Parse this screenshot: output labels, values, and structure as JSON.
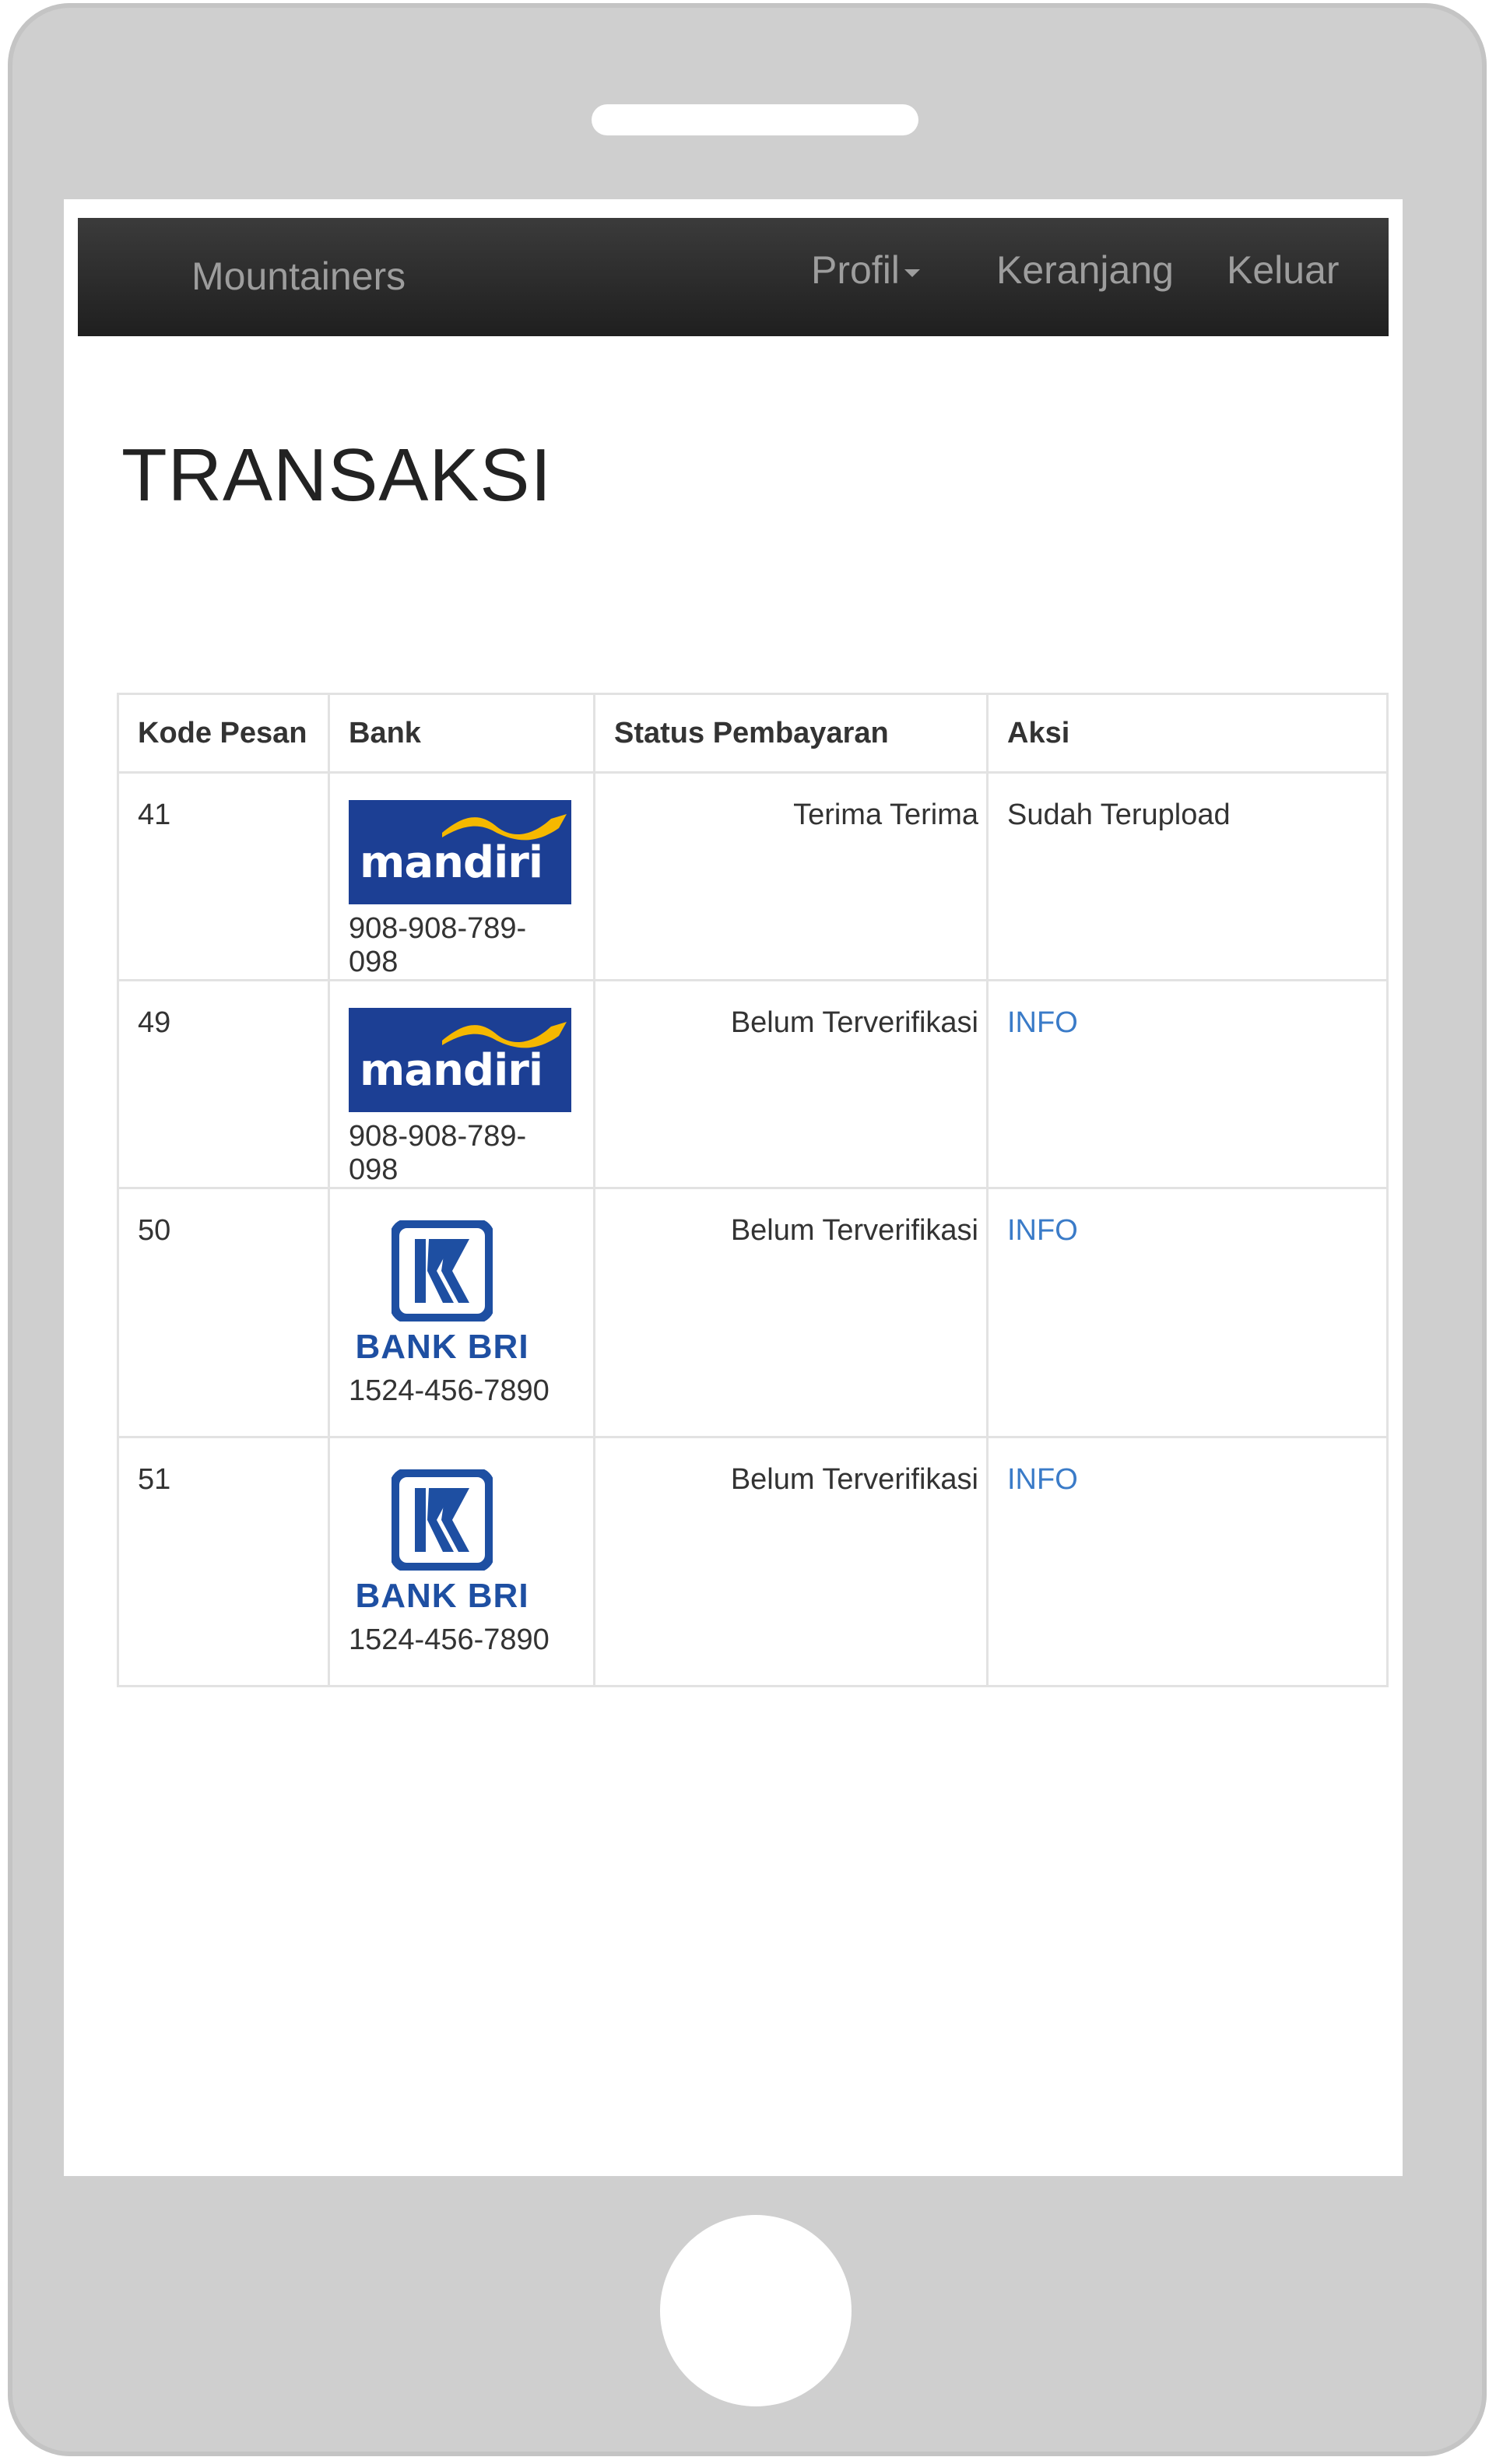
{
  "navbar": {
    "brand": "Mountainers",
    "items": [
      "Profil",
      "Keranjang",
      "Keluar"
    ]
  },
  "page": {
    "title": "TRANSAKSI"
  },
  "table": {
    "headers": [
      "Kode Pesan",
      "Bank",
      "Status Pembayaran",
      "Aksi"
    ],
    "rows": [
      {
        "kode": "41",
        "bank": "mandiri",
        "account": "908-908-789-098",
        "status": "Terima Terima",
        "aksi": "Sudah Terupload"
      },
      {
        "kode": "49",
        "bank": "mandiri",
        "account": "908-908-789-098",
        "status": "Belum Terverifikasi",
        "aksi": "INFO"
      },
      {
        "kode": "50",
        "bank": "BANK BRI",
        "account": "1524-456-7890",
        "status": "Belum Terverifikasi",
        "aksi": "INFO"
      },
      {
        "kode": "51",
        "bank": "BANK BRI",
        "account": "1524-456-7890",
        "status": "Belum Terverifikasi",
        "aksi": "INFO"
      }
    ]
  },
  "colors": {
    "navbar": "#222222",
    "link": "#3a7bc8",
    "mandiri_blue": "#1c3f94",
    "mandiri_gold": "#f5b800",
    "bri_blue": "#1e4fa2"
  },
  "icons": [
    "caret-down-icon",
    "mandiri-logo",
    "bri-logo"
  ]
}
